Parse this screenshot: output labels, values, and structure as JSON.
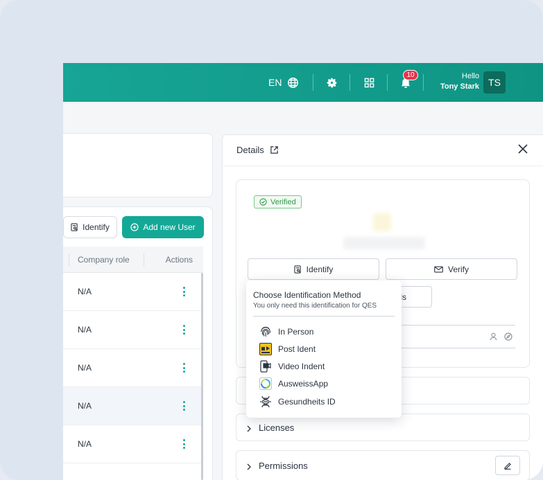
{
  "topbar": {
    "language": "EN",
    "notification_count": "10",
    "greeting": "Hello",
    "user_name": "Tony Stark",
    "avatar_initials": "TS"
  },
  "toolbar": {
    "identify_label": "Identify",
    "add_user_label": "Add new User"
  },
  "table": {
    "columns": [
      "Company role",
      "Actions"
    ],
    "rows": [
      {
        "company_role": "N/A"
      },
      {
        "company_role": "N/A"
      },
      {
        "company_role": "N/A"
      },
      {
        "company_role": "N/A"
      },
      {
        "company_role": "N/A"
      }
    ]
  },
  "details": {
    "title": "Details",
    "status_badge": "Verified",
    "identify_button": "Identify",
    "verify_button": "Verify",
    "partial_button_text": "ls",
    "sections": [
      {
        "label": "Licenses"
      },
      {
        "label": "Permissions"
      }
    ]
  },
  "identification_menu": {
    "title": "Choose Identification Method",
    "subtitle": "You only need this identification for QES",
    "options": [
      {
        "label": "In Person",
        "icon": "fingerprint-icon"
      },
      {
        "label": "Post Ident",
        "icon": "post-ident-icon"
      },
      {
        "label": "Video Indent",
        "icon": "video-ident-icon"
      },
      {
        "label": "AusweissApp",
        "icon": "ausweissapp-icon"
      },
      {
        "label": "Gesundheits ID",
        "icon": "dna-icon"
      }
    ]
  },
  "colors": {
    "brand": "#14a897",
    "badge_red": "#e8334a",
    "verified_green": "#2f9a48"
  }
}
